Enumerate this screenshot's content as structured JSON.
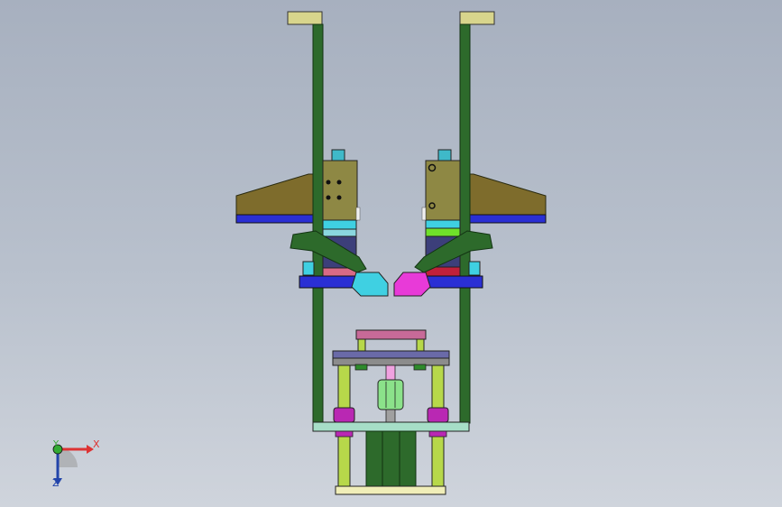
{
  "triad": {
    "x_label": "X",
    "y_label": "Y",
    "z_label": "Z"
  },
  "colors": {
    "background_top": "#a7b0bf",
    "background_bottom": "#cfd4dc",
    "frame_green": "#2d6a2b",
    "cap_yellow": "#d8d58c",
    "brown_plate": "#7e6c2c",
    "blue_plate": "#2a2fd4",
    "khaki_block": "#8e8844",
    "cyan_part": "#3fd0e2",
    "navy_body": "#3c3f7a",
    "pink_part": "#d86a86",
    "magenta_part": "#e83ad8",
    "purple_part": "#b928b3",
    "lime_rod": "#b7d84a",
    "mint_plate": "#a6dec7"
  }
}
